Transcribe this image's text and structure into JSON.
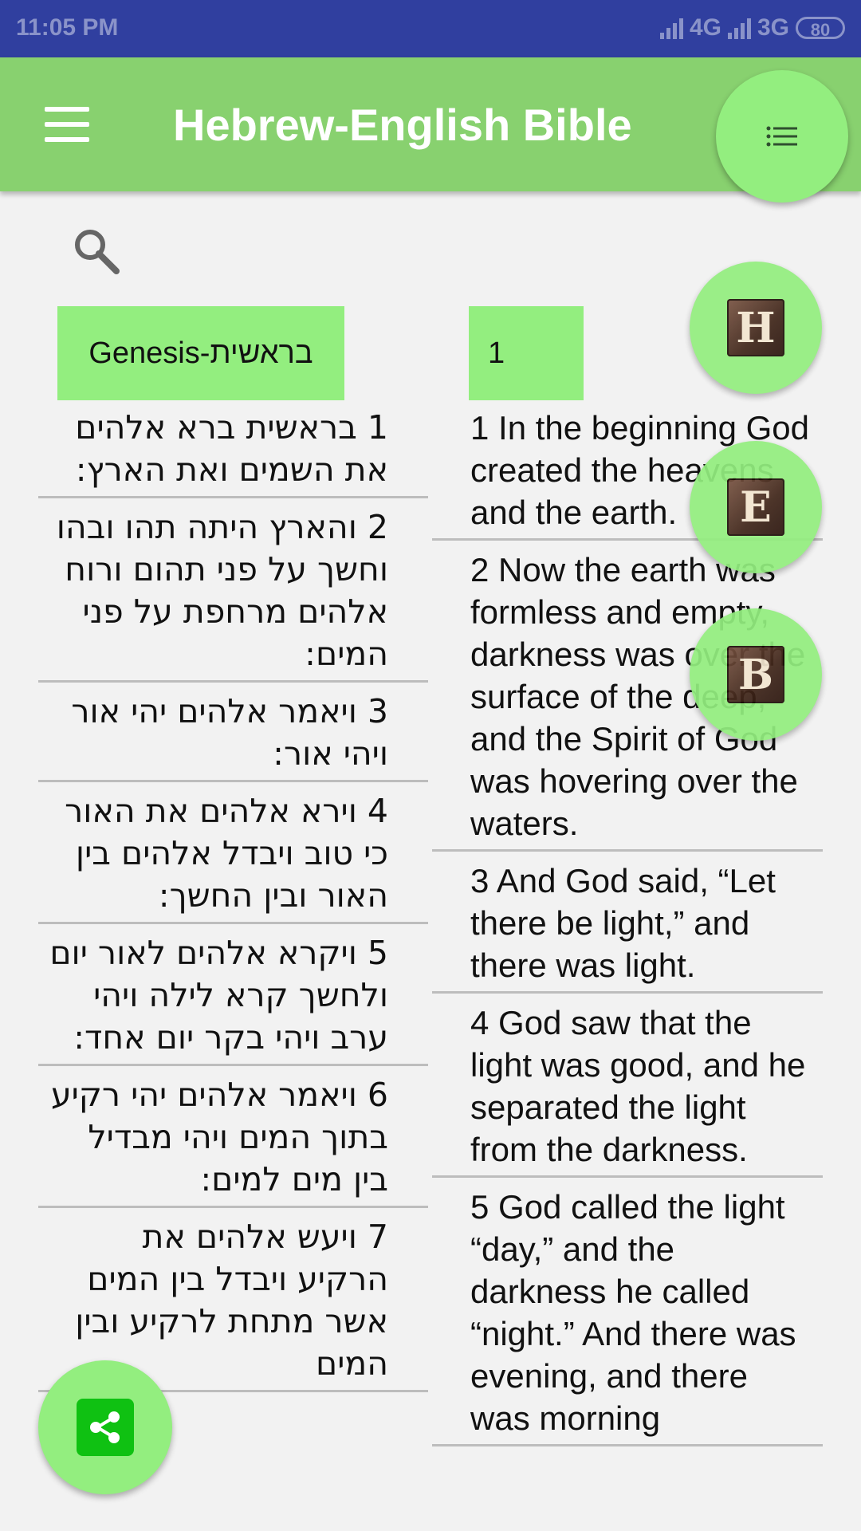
{
  "status_bar": {
    "time": "11:05 PM",
    "network1": "4G",
    "network2": "3G",
    "battery": "80"
  },
  "app_bar": {
    "title": "Hebrew-English Bible",
    "menu_icon": "hamburger-menu-icon",
    "list_icon": "list-icon"
  },
  "search": {
    "icon": "search-icon"
  },
  "selectors": {
    "book": "Genesis-בראשית",
    "chapter": "1"
  },
  "fabs": {
    "hebrew": "H",
    "english": "E",
    "both": "B",
    "share_icon": "share-icon"
  },
  "hebrew_verses": [
    "1 בראשית ברא אלהים את השמים ואת הארץ:",
    "2 והארץ היתה תהו ובהו וחשך על פני תהום ורוח אלהים מרחפת על פני המים:",
    "3 ויאמר אלהים יהי אור ויהי אור:",
    "4 וירא אלהים את האור כי טוב ויבדל אלהים בין האור ובין החשך:",
    "5 ויקרא אלהים לאור יום ולחשך קרא לילה ויהי ערב ויהי בקר יום אחד:",
    "6 ויאמר אלהים יהי רקיע בתוך המים ויהי מבדיל בין מים למים:",
    "7 ויעש אלהים את הרקיע ויבדל בין המים אשר מתחת לרקיע ובין המים"
  ],
  "english_verses": [
    "1 In the beginning God created the heavens and the earth.",
    "2 Now the earth was formless and empty, darkness was over the surface of the deep, and the Spirit of God was hovering over the waters.",
    "3 And God said, “Let there be light,” and there was light.",
    "4 God saw that the light was good, and he separated the light from the darkness.",
    "5 God called the light “day,” and the darkness he called “night.” And there was evening, and there was morning"
  ],
  "colors": {
    "status_bar": "#303f9f",
    "app_bar": "#88d16f",
    "accent": "#93ee7f",
    "background": "#f2f2f2"
  }
}
